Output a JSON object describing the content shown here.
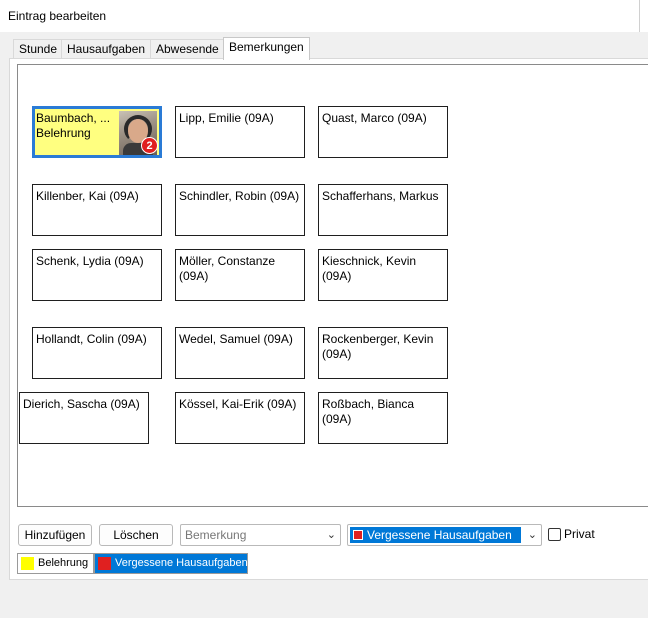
{
  "window": {
    "title": "Eintrag bearbeiten"
  },
  "tabs": [
    "Stunde",
    "Hausaufgaben",
    "Abwesende",
    "Bemerkungen"
  ],
  "active_tab": "Bemerkungen",
  "students": [
    {
      "name": "Baumbach, ...",
      "note": "Belehrung",
      "badge": "2",
      "selected": true
    },
    {
      "name": "Lipp, Emilie (09A)"
    },
    {
      "name": "Quast, Marco (09A)"
    },
    {
      "name": "Killenber, Kai (09A)"
    },
    {
      "name": "Schindler, Robin (09A)"
    },
    {
      "name": "Schafferhans, Markus"
    },
    {
      "name": "Schenk, Lydia (09A)"
    },
    {
      "name": "Möller, Constanze (09A)"
    },
    {
      "name": "Kieschnick, Kevin (09A)"
    },
    {
      "name": "Hollandt, Colin (09A)"
    },
    {
      "name": "Wedel, Samuel (09A)"
    },
    {
      "name": "Rockenberger, Kevin (09A)"
    },
    {
      "name": "Dierich, Sascha (09A)"
    },
    {
      "name": "Kössel, Kai-Erik (09A)"
    },
    {
      "name": "Roßbach, Bianca (09A)"
    }
  ],
  "toolbar": {
    "add_label": "Hinzufügen",
    "delete_label": "Löschen",
    "remark_placeholder": "Bemerkung",
    "category_value": "Vergessene Hausaufgaben",
    "private_label": "Privat",
    "private_checked": false
  },
  "legend": [
    {
      "label": "Belehrung",
      "color": "#ffff00"
    },
    {
      "label": "Vergessene Hausaufgaben",
      "color": "#e02020"
    }
  ],
  "colors": {
    "selected_card_bg": "#ffff80",
    "selection_border": "#2a7bd6",
    "accent": "#0078d7",
    "badge": "#e02020"
  }
}
